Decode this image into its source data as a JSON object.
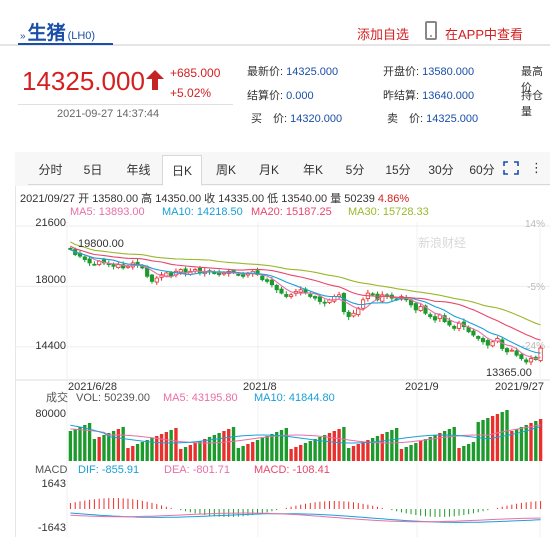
{
  "header": {
    "title_mark": "»",
    "title": "生猪",
    "code": "(LH0)",
    "add_favorite": "添加自选",
    "view_in_app": "在APP中查看"
  },
  "quote": {
    "price": "14325.000",
    "change": "+685.000",
    "change_pct": "+5.02%",
    "time": "2021-09-27 14:37:44",
    "fields": [
      {
        "label": "最新价:",
        "value": "14325.000"
      },
      {
        "label": "开盘价:",
        "value": "13580.000"
      },
      {
        "label": "最高价",
        "value": ""
      },
      {
        "label": "结算价:",
        "value": "0.000"
      },
      {
        "label": "昨结算:",
        "value": "13640.000"
      },
      {
        "label": "持仓量",
        "value": ""
      },
      {
        "label": "买　价:",
        "value": "14320.000"
      },
      {
        "label": "卖　价:",
        "value": "14325.000"
      }
    ]
  },
  "tabs": [
    {
      "label": "分时"
    },
    {
      "label": "5日"
    },
    {
      "label": "年线"
    },
    {
      "label": "日K"
    },
    {
      "label": "周K"
    },
    {
      "label": "月K"
    },
    {
      "label": "年K"
    },
    {
      "label": "5分"
    },
    {
      "label": "15分"
    },
    {
      "label": "30分"
    },
    {
      "label": "60分"
    }
  ],
  "active_tab": "日K",
  "kline_info": {
    "date": "2021/09/27",
    "open_label": "开",
    "open": "13580.00",
    "high_label": "高",
    "high": "14350.00",
    "close_label": "收",
    "close": "14335.00",
    "low_label": "低",
    "low": "13540.00",
    "vol_label": "量",
    "vol": "50239",
    "pct": "4.86%"
  },
  "ma": [
    {
      "label": "MA5: 13893.00",
      "color": "#e96fa8"
    },
    {
      "label": "MA10: 14218.50",
      "color": "#1aa0d8"
    },
    {
      "label": "MA20: 15187.25",
      "color": "#e9466e"
    },
    {
      "label": "MA30: 15728.33",
      "color": "#9ab82a"
    }
  ],
  "chart_data": {
    "type": "candlestick",
    "y_ticks": [
      "21600",
      "18000",
      "14400"
    ],
    "x_ticks": [
      "2021/6/28",
      "2021/8",
      "2021/9",
      "2021/9/27"
    ],
    "pct_ticks": [
      "14%",
      "-5%",
      "-24%"
    ],
    "annotations": {
      "max": "19800.00",
      "min": "13365.00"
    },
    "watermark": "新浪财经",
    "closes": [
      20200,
      19900,
      19800,
      19600,
      19400,
      19300,
      19500,
      19400,
      19300,
      19200,
      19300,
      19100,
      19200,
      19400,
      19300,
      19100,
      18600,
      18300,
      18500,
      18700,
      18800,
      18600,
      18900,
      19000,
      18800,
      18900,
      19000,
      18800,
      18900,
      18900,
      18800,
      18700,
      18800,
      18900,
      18800,
      18700,
      18600,
      18800,
      18900,
      18700,
      18400,
      18300,
      18100,
      17800,
      17600,
      17400,
      17500,
      17700,
      17800,
      17600,
      17400,
      17300,
      17100,
      17000,
      17200,
      17400,
      17500,
      16500,
      16200,
      16400,
      16700,
      17200,
      17600,
      17500,
      17200,
      17500,
      17400,
      17300,
      17200,
      17400,
      17200,
      16900,
      16600,
      16800,
      16400,
      16200,
      16000,
      16300,
      15900,
      15700,
      15500,
      15800,
      15600,
      15300,
      15100,
      14900,
      14700,
      14500,
      14700,
      14900,
      14300,
      14100,
      14200,
      13900,
      13700,
      13500,
      13700,
      13640,
      14325
    ],
    "volume_ticks": [
      "80000"
    ],
    "volume_labels": {
      "title": "成交",
      "vol": "VOL: 50239.00",
      "ma5": "MA5: 43195.80",
      "ma10": "MA10: 41844.80"
    },
    "macd_labels": {
      "title": "MACD",
      "dif": "DIF: -855.91",
      "dea": "DEA: -801.71",
      "macd": "MACD: -108.41"
    },
    "macd_ticks": [
      "1643",
      "-1643"
    ]
  },
  "colors": {
    "up": "#e8302c",
    "down": "#1c9b2c",
    "accent_blue": "#1a4ea8",
    "accent_red": "#d42020"
  }
}
